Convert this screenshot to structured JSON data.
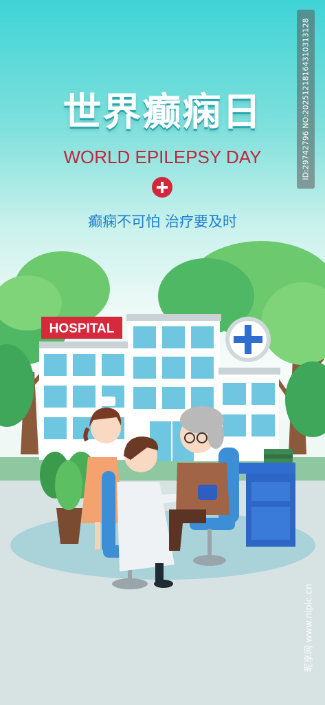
{
  "title_cn": "世界癫痫日",
  "title_en": "WORLD EPILEPSY DAY",
  "slogan": "癫痫不可怕  治疗要及时",
  "hospital_sign": "HOSPITAL",
  "side_id": "ID:29742796 NO:20251218164310313128",
  "watermark": "昵享网 www.nipic.cn",
  "icons": {
    "title_cross": "red-cross-icon",
    "building_cross": "blue-cross-icon"
  },
  "colors": {
    "title_en": "#c0263a",
    "slogan": "#1b7fd0",
    "cross_badge": "#d2283c"
  }
}
